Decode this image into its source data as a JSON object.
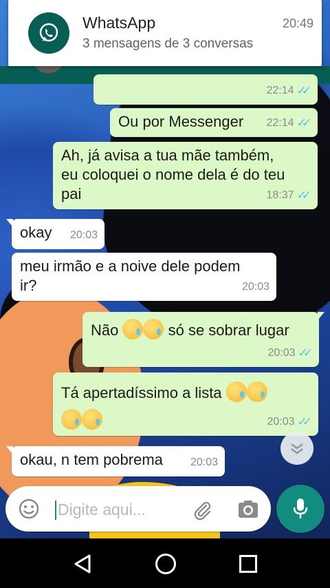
{
  "notification": {
    "app_name": "WhatsApp",
    "time": "20:49",
    "text": "3 mensagens de 3 conversas"
  },
  "messages": [
    {
      "direction": "out",
      "text": "",
      "time": "22:14",
      "status": "read"
    },
    {
      "direction": "out",
      "text": "Ou por Messenger",
      "time": "22:14",
      "status": "read"
    },
    {
      "direction": "out",
      "text_lines": [
        "Ah, já avisa a tua mãe também,",
        "eu coloquei o nome dela é do teu",
        "pai"
      ],
      "time": "18:37",
      "status": "read"
    },
    {
      "direction": "in",
      "text": "okay",
      "time": "20:03"
    },
    {
      "direction": "in",
      "text_lines": [
        "meu irmão e a noive dele podem",
        "ir?"
      ],
      "time": "20:03"
    },
    {
      "direction": "out",
      "text_before": "Não",
      "text_after": "só se sobrar lugar",
      "emoji": [
        "crying-face-icon",
        "crying-face-icon"
      ],
      "time": "20:03",
      "status": "read"
    },
    {
      "direction": "out",
      "text": "Tá apertadíssimo a lista",
      "emoji": [
        "crying-face-icon",
        "crying-face-icon",
        "crying-face-icon",
        "crying-face-icon"
      ],
      "time": "20:03",
      "status": "read"
    },
    {
      "direction": "in",
      "text": "okau, n tem pobrema",
      "time": "20:03"
    }
  ],
  "composer": {
    "placeholder": "Digite aqui..."
  },
  "colors": {
    "brand": "#075e54",
    "accent": "#128c7e",
    "outgoing_bubble": "#dcf8c6",
    "incoming_bubble": "#ffffff",
    "read_tick": "#4fc3f7"
  }
}
